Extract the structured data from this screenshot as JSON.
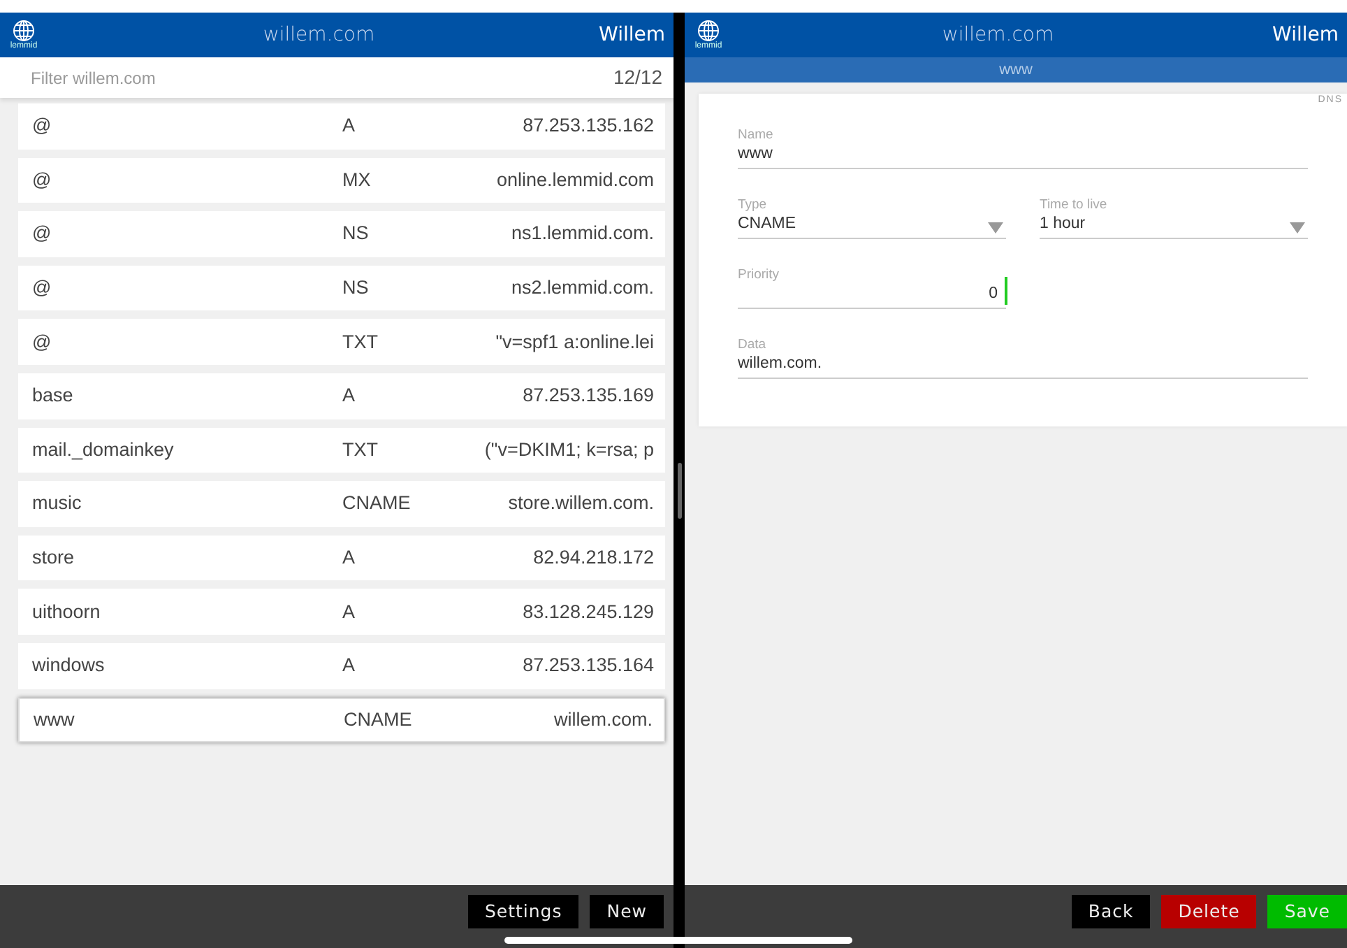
{
  "left": {
    "header": {
      "brand": "lemmid",
      "domain": "willem.com",
      "user": "Willem"
    },
    "filter": {
      "placeholder": "Filter willem.com",
      "count": "12/12"
    },
    "records": [
      {
        "name": "@",
        "type": "A",
        "data": "87.253.135.162",
        "selected": false
      },
      {
        "name": "@",
        "type": "MX",
        "data": "online.lemmid.com",
        "selected": false
      },
      {
        "name": "@",
        "type": "NS",
        "data": "ns1.lemmid.com.",
        "selected": false
      },
      {
        "name": "@",
        "type": "NS",
        "data": "ns2.lemmid.com.",
        "selected": false
      },
      {
        "name": "@",
        "type": "TXT",
        "data": "\"v=spf1 a:online.lei",
        "selected": false
      },
      {
        "name": "base",
        "type": "A",
        "data": "87.253.135.169",
        "selected": false
      },
      {
        "name": "mail._domainkey",
        "type": "TXT",
        "data": "(\"v=DKIM1; k=rsa; p",
        "selected": false
      },
      {
        "name": "music",
        "type": "CNAME",
        "data": "store.willem.com.",
        "selected": false
      },
      {
        "name": "store",
        "type": "A",
        "data": "82.94.218.172",
        "selected": false
      },
      {
        "name": "uithoorn",
        "type": "A",
        "data": "83.128.245.129",
        "selected": false
      },
      {
        "name": "windows",
        "type": "A",
        "data": "87.253.135.164",
        "selected": false
      },
      {
        "name": "www",
        "type": "CNAME",
        "data": "willem.com.",
        "selected": true
      }
    ],
    "buttons": [
      {
        "label": "Settings"
      },
      {
        "label": "New"
      }
    ]
  },
  "right": {
    "header": {
      "brand": "lemmid",
      "domain": "willem.com",
      "user": "Willem"
    },
    "subtitle": "www",
    "card_tag": "DNS",
    "fields": [
      {
        "label": "Name",
        "value": "www",
        "kind": "text"
      },
      {
        "label": "Type",
        "value": "CNAME",
        "kind": "select"
      },
      {
        "label": "Time to live",
        "value": "1 hour",
        "kind": "select"
      },
      {
        "label": "Priority",
        "value": "0",
        "kind": "number",
        "focused": true
      },
      {
        "label": "Data",
        "value": "willem.com.",
        "kind": "text"
      }
    ],
    "buttons": [
      {
        "label": "Back",
        "kind": "plain"
      },
      {
        "label": "Delete",
        "kind": "danger"
      },
      {
        "label": "Save",
        "kind": "success"
      }
    ]
  }
}
